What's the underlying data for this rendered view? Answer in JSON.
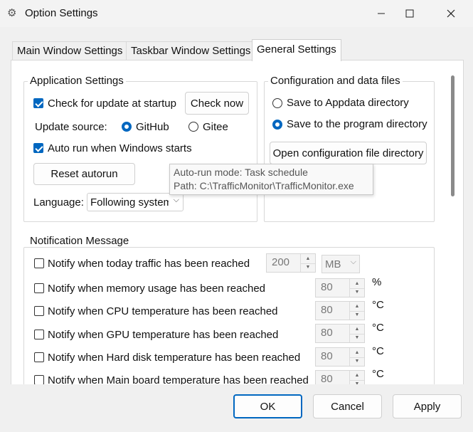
{
  "window": {
    "title": "Option Settings",
    "icon": "gear-icon"
  },
  "tabs": [
    {
      "label": "Main Window Settings",
      "active": false
    },
    {
      "label": "Taskbar Window Settings",
      "active": false
    },
    {
      "label": "General Settings",
      "active": true
    }
  ],
  "app_settings": {
    "title": "Application Settings",
    "check_update_label": "Check for update at startup",
    "check_update_checked": true,
    "check_now_label": "Check now",
    "update_source_label": "Update source:",
    "source_github": "GitHub",
    "source_gitee": "Gitee",
    "auto_run_label": "Auto run when Windows starts",
    "auto_run_checked": true,
    "reset_autorun_label": "Reset autorun",
    "language_label": "Language:",
    "language_value": "Following system"
  },
  "config": {
    "title": "Configuration and data files",
    "save_appdata": "Save to Appdata directory",
    "save_program": "Save to the program directory",
    "open_dir_label": "Open configuration file directory"
  },
  "tooltip": {
    "line1": "Auto-run mode: Task schedule",
    "line2": "Path: C:\\TrafficMonitor\\TrafficMonitor.exe"
  },
  "notification": {
    "title": "Notification Message",
    "items": [
      {
        "label": "Notify when today traffic has been reached",
        "value": "200",
        "unit": "MB"
      },
      {
        "label": "Notify when memory usage has been reached",
        "value": "80",
        "unit": "%"
      },
      {
        "label": "Notify when CPU temperature has been reached",
        "value": "80",
        "unit": "°C"
      },
      {
        "label": "Notify when GPU temperature has been reached",
        "value": "80",
        "unit": "°C"
      },
      {
        "label": "Notify when Hard disk temperature has been reached",
        "value": "80",
        "unit": "°C"
      },
      {
        "label": "Notify when Main board temperature has been reached",
        "value": "80",
        "unit": "°C"
      }
    ]
  },
  "buttons": {
    "ok": "OK",
    "cancel": "Cancel",
    "apply": "Apply"
  },
  "colors": {
    "accent": "#0067c0",
    "border": "#d8d8d8"
  }
}
